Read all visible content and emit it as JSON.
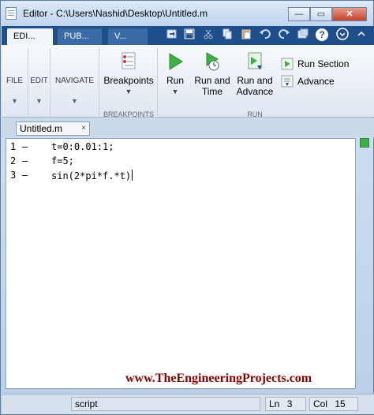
{
  "window": {
    "title": "Editor - C:\\Users\\Nashid\\Desktop\\Untitled.m",
    "controls": {
      "minimize": "—",
      "maximize": "▭",
      "close": "✕"
    }
  },
  "tabs": [
    {
      "label": "EDI..."
    },
    {
      "label": "PUB..."
    },
    {
      "label": "V..."
    }
  ],
  "ribbon": {
    "file_label": "FILE",
    "edit_label": "EDIT",
    "navigate_label": "NAVIGATE",
    "breakpoints_label": "Breakpoints",
    "breakpoints_section": "BREAKPOINTS",
    "run_label": "Run",
    "run_and_time_line1": "Run and",
    "run_and_time_line2": "Time",
    "run_and_advance_line1": "Run and",
    "run_and_advance_line2": "Advance",
    "run_section_label": "Run Section",
    "advance_label": "Advance",
    "run_section": "RUN"
  },
  "file_tab": {
    "label": "Untitled.m"
  },
  "code_lines": [
    {
      "num": "1",
      "marker": "—",
      "code": "t=0:0.01:1;"
    },
    {
      "num": "2",
      "marker": "—",
      "code": "f=5;"
    },
    {
      "num": "3",
      "marker": "—",
      "code": "sin(2*pi*f.*t)"
    }
  ],
  "watermark": "www.TheEngineeringProjects.com",
  "status": {
    "mode": "script",
    "ln_label": "Ln",
    "ln_value": "3",
    "col_label": "Col",
    "col_value": "15"
  },
  "colors": {
    "accent": "#1f4f8b",
    "run_green": "#3cb043",
    "watermark": "#8b0000"
  }
}
